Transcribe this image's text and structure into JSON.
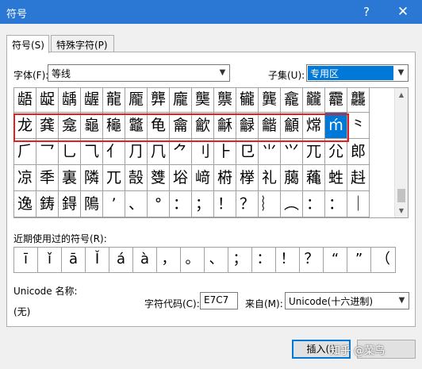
{
  "window": {
    "title": "符号",
    "help": "?",
    "close": "✕"
  },
  "tabs": [
    {
      "label": "符号(S)",
      "active": true
    },
    {
      "label": "特殊字符(P)",
      "active": false
    }
  ],
  "font": {
    "label": "字体(F):",
    "value": "等线"
  },
  "subset": {
    "label": "子集(U):",
    "value": "专用区"
  },
  "symbol_grid": {
    "rows": [
      [
        "龉",
        "龊",
        "龋",
        "龌",
        "龍",
        "龎",
        "龏",
        "龐",
        "龑",
        "龒",
        "龓",
        "龔",
        "龕",
        "龖",
        "龗",
        "龘"
      ],
      [
        "龙",
        "龚",
        "龛",
        "龜",
        "龝",
        "龞",
        "龟",
        "龠",
        "龡",
        "龢",
        "龣",
        "龤",
        "龥",
        "龦",
        "ḿ",
        "⺀"
      ],
      [
        "⺁",
        "⺂",
        "⺃",
        "⺄",
        "⺅",
        "⺆",
        "⺇",
        "⺈",
        "⺉",
        "⺊",
        "⺋",
        "⺌",
        "⺍",
        "⺎",
        "⺏",
        "郎"
      ],
      [
        "凉",
        "秊",
        "裏",
        "隣",
        "兀",
        "嗀",
        "﨎",
        "﨏",
        "﨑",
        "﨓",
        "﨔",
        "礼",
        "﨟",
        "蘒",
        "﨡",
        "﨣"
      ],
      [
        "逸",
        "鋳",
        "鍀",
        "隝",
        "’",
        "、",
        "°",
        "：",
        "；",
        "！",
        "？",
        "︴",
        "︵",
        "：",
        "：",
        "｜"
      ]
    ],
    "selected_row": 1,
    "selected_col": 14
  },
  "recent": {
    "label": "近期使用过的符号(R):",
    "symbols": [
      "ī",
      "ǐ",
      "ā",
      "Ǐ",
      "á",
      "à",
      "，",
      "。",
      "、",
      "；",
      "：",
      "！",
      "？",
      "“",
      "”",
      "（"
    ]
  },
  "unicode": {
    "name_label": "Unicode 名称:",
    "name_value": "(无)"
  },
  "char_code": {
    "label": "字符代码(C):",
    "value": "E7C7"
  },
  "from": {
    "label": "来自(M):",
    "value": "Unicode(十六进制)"
  },
  "buttons": {
    "insert": "插入(I)"
  },
  "watermark": "知乎 @菜鸟"
}
